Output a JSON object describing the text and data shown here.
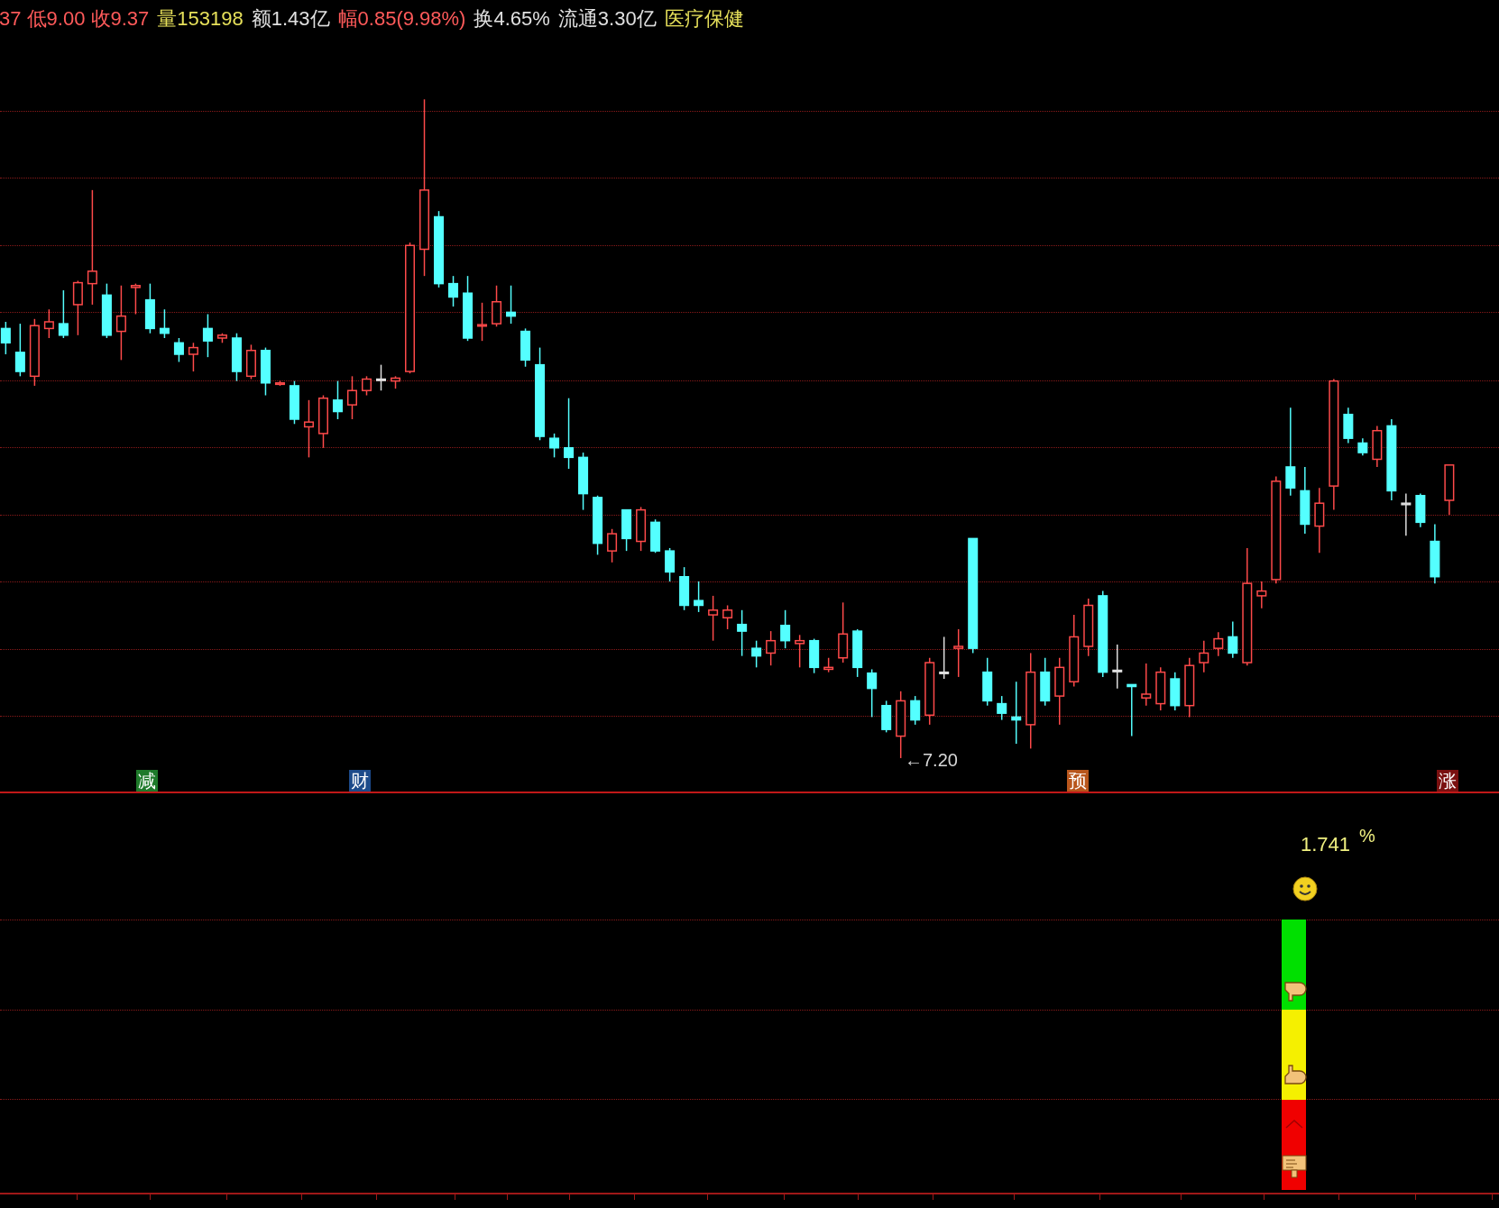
{
  "quote_bar": [
    {
      "text": "37 低9.00 收9.37",
      "color": "#ff5a5a"
    },
    {
      "text": "量153198",
      "color": "#e6e05a"
    },
    {
      "text": "额1.43亿",
      "color": "#e0e0e0"
    },
    {
      "text": "幅0.85(9.98%)",
      "color": "#ff5a5a"
    },
    {
      "text": "换4.65%",
      "color": "#e0e0e0"
    },
    {
      "text": "流通3.30亿",
      "color": "#e0e0e0"
    },
    {
      "text": "医疗保健",
      "color": "#e6e05a"
    }
  ],
  "chart": {
    "low_label": "←7.20",
    "markers": [
      {
        "text": "减",
        "color": "#1e7a2a"
      },
      {
        "text": "财",
        "color": "#1c4a8a"
      },
      {
        "text": "预",
        "color": "#b8561c"
      },
      {
        "text": "涨",
        "color": "#7a1010"
      }
    ]
  },
  "indicator": {
    "value": "1.741",
    "unit": "%"
  }
}
